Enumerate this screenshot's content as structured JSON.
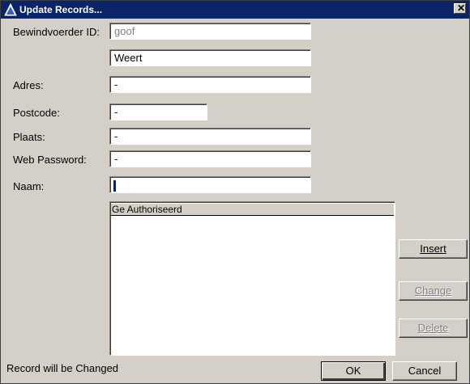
{
  "window": {
    "title": "Update Records..."
  },
  "form": {
    "bewindvoerder_label": "Bewindvoerder ID:",
    "bewindvoerder_value": "goof",
    "unnamed_value": "Weert",
    "adres_label": "Adres:",
    "adres_value": "-",
    "postcode_label": "Postcode:",
    "postcode_value": "-",
    "plaats_label": "Plaats:",
    "plaats_value": "-",
    "webpassword_label": "Web Password:",
    "webpassword_value": "-",
    "naam_label": "Naam:",
    "naam_value": "-"
  },
  "list": {
    "header": "Ge Authoriseerd",
    "items": []
  },
  "buttons": {
    "insert": "Insert",
    "change": "Change",
    "delete": "Delete",
    "ok": "OK",
    "cancel": "Cancel"
  },
  "status": "Record will be Changed",
  "colors": {
    "titlebar": "#0a246a",
    "face": "#d4d0c8",
    "disabled_text": "#808080"
  }
}
